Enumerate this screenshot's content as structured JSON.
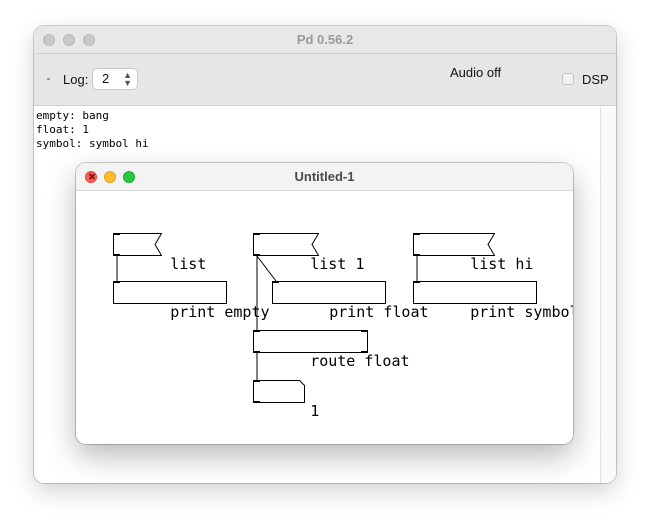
{
  "main_window": {
    "title": "Pd 0.56.2",
    "toolbar": {
      "log_label": "Log:",
      "log_value": "2",
      "audio_status": "Audio off",
      "dsp_label": "DSP",
      "dsp_checked": false
    },
    "console": {
      "lines": [
        "empty: bang",
        "float: 1",
        "symbol: symbol hi"
      ]
    }
  },
  "patch_window": {
    "title": "Untitled-1",
    "objects": {
      "msg_list": "list",
      "msg_list_1": "list 1",
      "msg_list_hi": "list hi",
      "print_empty": "print empty",
      "print_float": "print float",
      "print_symbol": "print symbol",
      "route_float": "route float",
      "number_atom": "1"
    }
  },
  "colors": {
    "close": "#ff5f57",
    "minimize": "#febc2e",
    "zoom": "#28c840",
    "inactive_traffic": "#c9c9c9"
  }
}
